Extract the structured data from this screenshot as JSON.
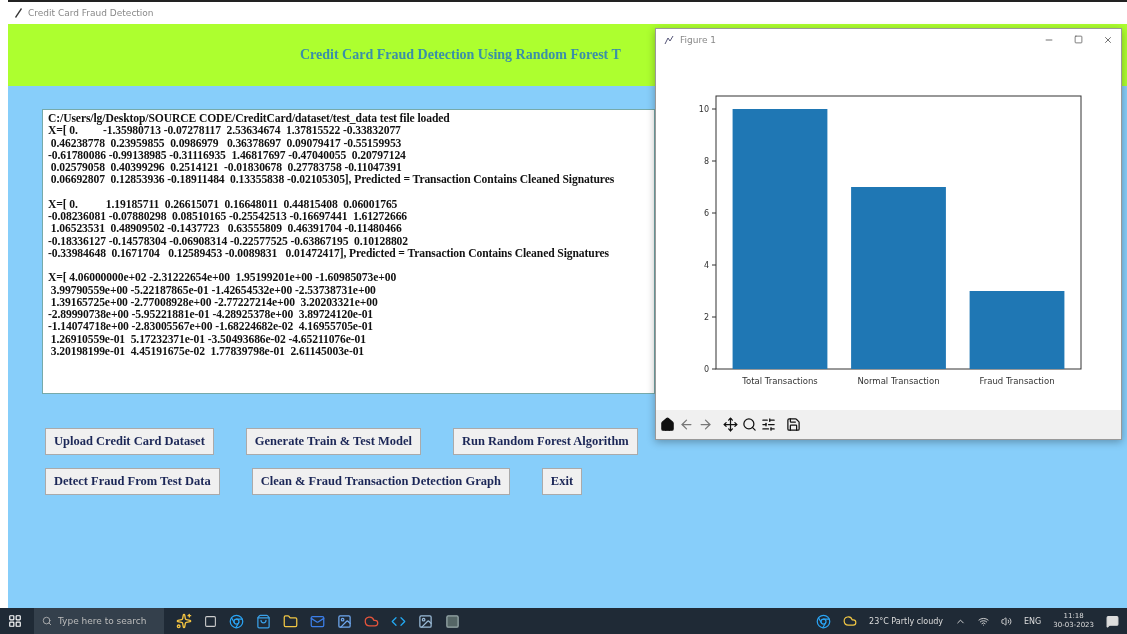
{
  "app_window": {
    "title": "Credit Card Fraud Detection"
  },
  "header": {
    "title": "Credit Card Fraud Detection Using Random Forest T"
  },
  "output": {
    "path_line": "C:/Users/lg/Desktop/SOURCE CODE/CreditCard/dataset/test_data test file loaded",
    "records": [
      [
        "X=[ 0.         -1.35980713 -0.07278117  2.53634674  1.37815522 -0.33832077",
        " 0.46238778  0.23959855  0.0986979   0.36378697  0.09079417 -0.55159953",
        "-0.61780086 -0.99138985 -0.31116935  1.46817697 -0.47040055  0.20797124",
        " 0.02579058  0.40399296  0.2514121  -0.01830678  0.27783758 -0.11047391",
        " 0.06692807  0.12853936 -0.18911484  0.13355838 -0.02105305], Predicted = Transaction Contains Cleaned Signatures"
      ],
      [
        "X=[ 0.          1.19185711  0.26615071  0.16648011  0.44815408  0.06001765",
        "-0.08236081 -0.07880298  0.08510165 -0.25542513 -0.16697441  1.61272666",
        " 1.06523531  0.48909502 -0.1437723   0.63555809  0.46391704 -0.11480466",
        "-0.18336127 -0.14578304 -0.06908314 -0.22577525 -0.63867195  0.10128802",
        "-0.33984648  0.1671704   0.12589453 -0.0089831   0.01472417], Predicted = Transaction Contains Cleaned Signatures"
      ],
      [
        "X=[ 4.06000000e+02 -2.31222654e+00  1.95199201e+00 -1.60985073e+00",
        " 3.99790559e+00 -5.22187865e-01 -1.42654532e+00 -2.53738731e+00",
        " 1.39165725e+00 -2.77008928e+00 -2.77227214e+00  3.20203321e+00",
        "-2.89990738e+00 -5.95221881e-01 -4.28925378e+00  3.89724120e-01",
        "-1.14074718e+00 -2.83005567e+00 -1.68224682e-02  4.16955705e-01",
        " 1.26910559e-01  5.17232371e-01 -3.50493686e-02 -4.65211076e-01",
        " 3.20198199e-01  4.45191675e-02  1.77839798e-01  2.61145003e-01"
      ]
    ]
  },
  "button_rows": [
    [
      "Upload Credit Card Dataset",
      "Generate Train & Test Model",
      "Run Random Forest Algorithm"
    ],
    [
      "Detect Fraud From Test Data",
      "Clean & Fraud Transaction Detection Graph",
      "Exit"
    ]
  ],
  "figure_window": {
    "title": "Figure 1",
    "chart_data": {
      "type": "bar",
      "categories": [
        "Total Transactions",
        "Normal Transaction",
        "Fraud Transaction"
      ],
      "values": [
        10,
        7,
        3
      ],
      "ylim": [
        0,
        10.5
      ],
      "yticks": [
        0,
        2,
        4,
        6,
        8,
        10
      ]
    }
  },
  "taskbar": {
    "search": {
      "placeholder": "Type here to search"
    },
    "weather": "23°C  Partly cloudy",
    "language": "ENG",
    "time": "11:18",
    "date": "30-03-2023"
  }
}
